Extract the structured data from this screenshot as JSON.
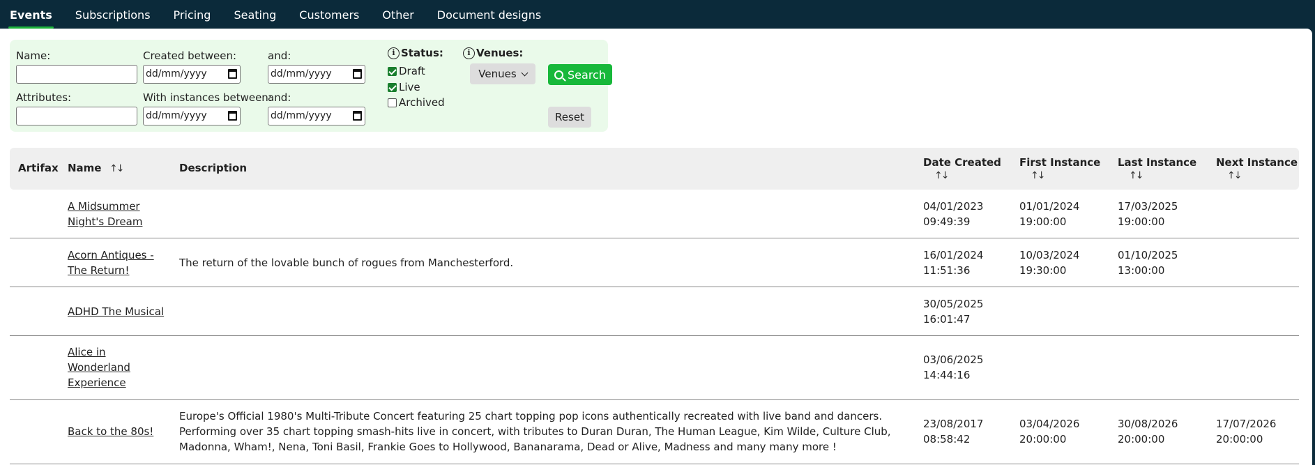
{
  "nav": {
    "tabs": [
      "Events",
      "Subscriptions",
      "Pricing",
      "Seating",
      "Customers",
      "Other",
      "Document designs"
    ],
    "active": "Events"
  },
  "filter": {
    "name_label": "Name:",
    "name_value": "",
    "created_between_label": "Created between:",
    "and_label_1": "and:",
    "date_placeholder": "dd/mm/yyyy",
    "attributes_label": "Attributes:",
    "attributes_value": "",
    "instances_between_label": "With instances between:",
    "and_label_2": "and:",
    "status_label": "Status:",
    "status_options": [
      {
        "label": "Draft",
        "checked": true
      },
      {
        "label": "Live",
        "checked": true
      },
      {
        "label": "Archived",
        "checked": false
      }
    ],
    "venues_label": "Venues:",
    "venues_button": "Venues",
    "search_button": "Search",
    "reset_button": "Reset"
  },
  "table": {
    "headers": {
      "artifax": "Artifax",
      "name": "Name",
      "description": "Description",
      "date_created": "Date Created",
      "first_instance": "First Instance",
      "last_instance": "Last Instance",
      "next_instance": "Next Instance"
    },
    "rows": [
      {
        "name": "A Midsummer Night's Dream",
        "description": "",
        "date_created": [
          "04/01/2023",
          "09:49:39"
        ],
        "first_instance": [
          "01/01/2024",
          "19:00:00"
        ],
        "last_instance": [
          "17/03/2025",
          "19:00:00"
        ],
        "next_instance": [
          "",
          ""
        ]
      },
      {
        "name": "Acorn Antiques - The Return!",
        "description": "The return of the lovable bunch of rogues from Manchesterford.",
        "date_created": [
          "16/01/2024",
          "11:51:36"
        ],
        "first_instance": [
          "10/03/2024",
          "19:30:00"
        ],
        "last_instance": [
          "01/10/2025",
          "13:00:00"
        ],
        "next_instance": [
          "",
          ""
        ]
      },
      {
        "name": "ADHD The Musical",
        "description": "",
        "date_created": [
          "30/05/2025",
          "16:01:47"
        ],
        "first_instance": [
          "",
          ""
        ],
        "last_instance": [
          "",
          ""
        ],
        "next_instance": [
          "",
          ""
        ]
      },
      {
        "name": "Alice in Wonderland Experience",
        "description": "",
        "date_created": [
          "03/06/2025",
          "14:44:16"
        ],
        "first_instance": [
          "",
          ""
        ],
        "last_instance": [
          "",
          ""
        ],
        "next_instance": [
          "",
          ""
        ]
      },
      {
        "name": "Back to the 80s!",
        "description": "Europe's Official 1980's Multi-Tribute Concert featuring 25 chart topping pop icons authentically recreated with live band and dancers. Performing over 35 chart topping smash-hits live in concert, with tributes to Duran Duran, The Human League, Kim Wilde, Culture Club, Madonna, Wham!, Nena, Toni Basil, Frankie Goes to Hollywood, Bananarama, Dead or Alive, Madness and many many more !",
        "date_created": [
          "23/08/2017",
          "08:58:42"
        ],
        "first_instance": [
          "03/04/2026",
          "20:00:00"
        ],
        "last_instance": [
          "30/08/2026",
          "20:00:00"
        ],
        "next_instance": [
          "17/07/2026",
          "20:00:00"
        ]
      }
    ]
  },
  "colors": {
    "nav_bg": "#0b2a3a",
    "accent": "#17b83a",
    "filter_bg": "#eafaea"
  }
}
